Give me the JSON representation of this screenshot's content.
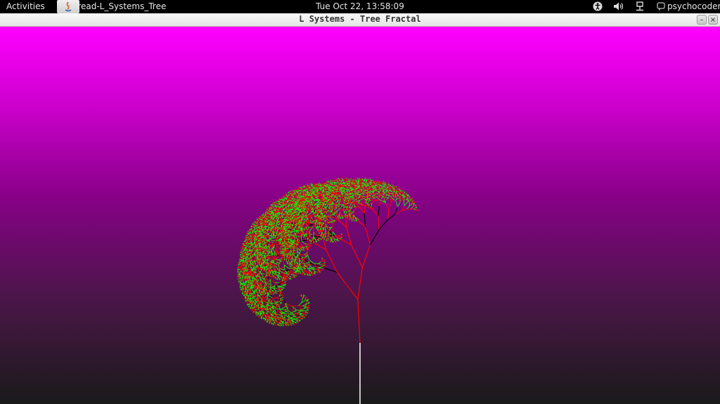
{
  "topbar": {
    "activities_label": "Activities",
    "app_title": "thread-L_Systems_Tree",
    "clock": "Tue Oct 22, 13:58:09",
    "username": "psychocoder",
    "icons": [
      "java-app-icon",
      "accessibility-icon",
      "volume-icon",
      "network-icon",
      "user-chat-icon"
    ]
  },
  "window": {
    "title": "L Systems - Tree Fractal",
    "controls": [
      "minimize",
      "close"
    ],
    "canvas": {
      "background_top": "#ff00ff",
      "background_bottom": "#1a1a1a",
      "trunk_color": "#ffffff",
      "branch_colors": [
        "#ff0000",
        "#00ff00",
        "#000000"
      ]
    }
  }
}
